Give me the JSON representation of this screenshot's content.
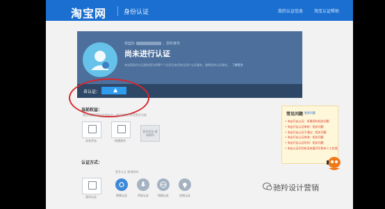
{
  "header": {
    "logo": "淘宝网",
    "title": "身份认证",
    "nav": [
      "我的认证信息",
      "淘宝认证帮助"
    ]
  },
  "panel": {
    "greeting_prefix": "依篮好",
    "greeting_suffix": "，您的身份",
    "status": "尚未进行认证",
    "description": "淘宝网身份认证服务是为保障个人信息及各项安全用户认证服务，激情您的认证服务。",
    "link": "了解更多",
    "start_label": "去认证：",
    "start_button": "立即认证"
  },
  "sections": {
    "current_level": "当前权益：",
    "current_level_sub": "使用认证后您在交易安全、商品发布时享受更多功能",
    "tiles": [
      {
        "label": "实名开店"
      },
      {
        "label": "快速身份"
      },
      {
        "label": "更多权益 敬请期待"
      }
    ],
    "methods": "认证方式：",
    "methods_sub": "更多认证 敬请期待",
    "method_items": [
      {
        "label": "身份认证"
      },
      {
        "label": "视频认证"
      },
      {
        "label": "声纹认证"
      },
      {
        "label": "网银认证"
      },
      {
        "label": "实地认证"
      }
    ]
  },
  "faq": {
    "title": "常见问题",
    "more": "更多问题",
    "items": [
      "淘宝开店认证：所需资料相关问题",
      "淘宝开店认证审核：相关问题",
      "淘宝开店认证不通过：相关问题",
      "淘宝开店认证修改：相关问题",
      "淘宝开店认证时间：相关问题",
      "淘宝认证识别有没有疑问可联系人工处理"
    ]
  },
  "watermark": "驰羚设计营销",
  "colors": {
    "topbar": "#1a6fd0",
    "panel": "#4c6f9b",
    "highlight": "#d8262b"
  }
}
